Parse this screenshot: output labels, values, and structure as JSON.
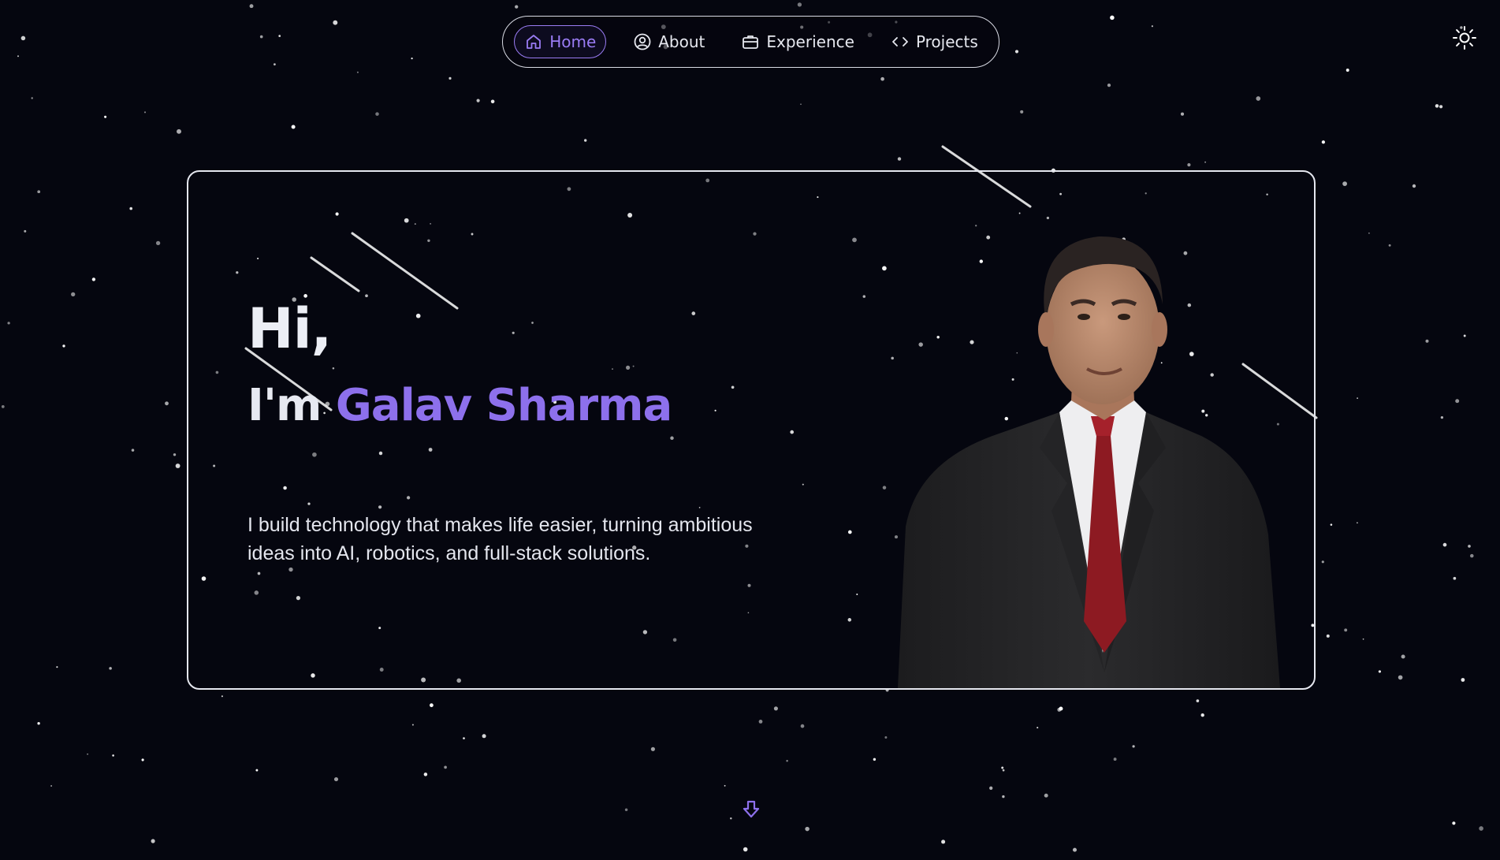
{
  "nav": {
    "items": [
      {
        "label": "Home",
        "icon": "home-icon",
        "active": true
      },
      {
        "label": "About",
        "icon": "user-circle-icon",
        "active": false
      },
      {
        "label": "Experience",
        "icon": "briefcase-icon",
        "active": false
      },
      {
        "label": "Projects",
        "icon": "code-icon",
        "active": false
      }
    ],
    "accent": "#9a7cf4"
  },
  "theme_toggle": {
    "icon": "sun-icon"
  },
  "hero": {
    "greeting": "Hi,",
    "intro_prefix": "I'm ",
    "name": "Galav Sharma",
    "tagline": "I build technology that makes life easier, turning ambitious ideas into AI, robotics, and full-stack solutions.",
    "portrait": "portrait of a man in a dark suit, white shirt and red tie"
  },
  "scroll_hint": {
    "icon": "arrow-down-icon"
  },
  "colors": {
    "background": "#05060f",
    "accent": "#8d70ec",
    "text": "#e9ebf2"
  }
}
